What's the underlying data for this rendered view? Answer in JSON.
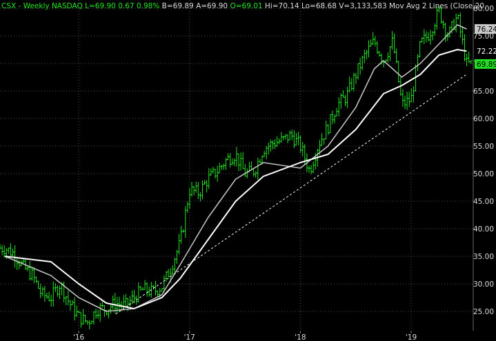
{
  "header": {
    "symbol": "CSX",
    "period": "Weekly",
    "exchange": "NASDAQ",
    "last": "L=69.90",
    "change": "0.67",
    "change_pct": "0.98%",
    "bid": "B=69.89",
    "ask": "A=69.90",
    "open": "O=69.01",
    "high": "Hi=70.14",
    "low": "Lo=68.68",
    "volume": "V=3,133,583",
    "study": "Mov Avg 2 Lines (Close,20,",
    "colors": {
      "accent_green": "#22e622",
      "text": "#dcdcdc"
    }
  },
  "price_tags": [
    {
      "label": "76.24",
      "value": 76.24,
      "bg": "#c8c8c8",
      "fg": "#000000"
    },
    {
      "label": "72.22",
      "value": 72.22,
      "bg": "#000000",
      "fg": "#ffffff"
    },
    {
      "label": "69.89",
      "value": 69.89,
      "bg": "#22dd22",
      "fg": "#000000"
    }
  ],
  "chart_data": {
    "type": "line",
    "title": "",
    "xlabel": "",
    "ylabel": "",
    "ylim": [
      21.5,
      81.5
    ],
    "y_ticks": [
      "25.00",
      "30.00",
      "35.00",
      "40.00",
      "45.00",
      "50.00",
      "55.00",
      "60.00",
      "65.00",
      "70.00",
      "75.00",
      "80.00"
    ],
    "x_ticks": [
      "'16",
      "'17",
      "'18",
      "'19"
    ],
    "grid": true,
    "colors": {
      "bars": "#22e622",
      "ma20": "#c0c0c0",
      "ma40": "#ffffff",
      "trendline": "#ffffff",
      "grid": "#505050",
      "background": "#000000"
    },
    "series": [
      {
        "name": "CSX",
        "type": "ohlc-bars",
        "x": [
          "2015-05",
          "2015-06",
          "2015-07",
          "2015-08",
          "2015-09",
          "2015-10",
          "2015-11",
          "2015-12",
          "2016-01",
          "2016-02",
          "2016-03",
          "2016-04",
          "2016-05",
          "2016-06",
          "2016-07",
          "2016-08",
          "2016-09",
          "2016-10",
          "2016-11",
          "2016-12",
          "2017-01",
          "2017-02",
          "2017-03",
          "2017-04",
          "2017-05",
          "2017-06",
          "2017-07",
          "2017-08",
          "2017-09",
          "2017-10",
          "2017-11",
          "2017-12",
          "2018-01",
          "2018-02",
          "2018-03",
          "2018-04",
          "2018-05",
          "2018-06",
          "2018-07",
          "2018-08",
          "2018-09",
          "2018-10",
          "2018-11",
          "2018-12",
          "2019-01",
          "2019-02",
          "2019-03",
          "2019-04",
          "2019-05",
          "2019-06",
          "2019-07"
        ],
        "values": [
          36.5,
          35.5,
          33.0,
          31.5,
          28.0,
          27.5,
          30.0,
          26.5,
          24.0,
          23.0,
          25.5,
          25.5,
          26.5,
          26.0,
          27.5,
          29.0,
          28.5,
          29.5,
          33.0,
          37.5,
          47.0,
          46.5,
          49.0,
          50.5,
          52.5,
          53.5,
          50.0,
          50.5,
          54.5,
          55.5,
          56.0,
          57.0,
          55.0,
          50.5,
          55.5,
          58.5,
          62.5,
          64.0,
          68.0,
          71.5,
          74.0,
          70.5,
          74.0,
          62.5,
          63.5,
          73.5,
          75.5,
          79.5,
          75.0,
          78.5,
          69.9
        ]
      },
      {
        "name": "",
        "type": "moving-average",
        "x": [
          "2015-05",
          "2015-10",
          "2016-01",
          "2016-04",
          "2016-07",
          "2016-10",
          "2016-12",
          "2017-03",
          "2017-06",
          "2017-09",
          "2018-01",
          "2018-04",
          "2018-07",
          "2018-09",
          "2018-10",
          "2018-12",
          "2019-02",
          "2019-04",
          "2019-06",
          "2019-07"
        ],
        "values": [
          35.0,
          31.5,
          27.5,
          25.0,
          25.5,
          28.0,
          33.5,
          42.0,
          49.0,
          52.0,
          51.0,
          55.0,
          62.0,
          69.0,
          70.5,
          67.5,
          70.0,
          73.5,
          77.0,
          76.24
        ]
      },
      {
        "name": "",
        "type": "moving-average",
        "x": [
          "2015-05",
          "2015-10",
          "2016-01",
          "2016-04",
          "2016-07",
          "2016-10",
          "2016-12",
          "2017-03",
          "2017-06",
          "2017-09",
          "2018-01",
          "2018-04",
          "2018-07",
          "2018-10",
          "2018-12",
          "2019-02",
          "2019-04",
          "2019-06",
          "2019-07"
        ],
        "values": [
          35.0,
          34.0,
          30.0,
          26.5,
          25.5,
          27.5,
          31.0,
          38.0,
          45.0,
          49.5,
          52.0,
          53.5,
          58.0,
          64.5,
          66.0,
          68.0,
          71.5,
          72.5,
          72.22
        ]
      },
      {
        "name": "",
        "type": "trendline",
        "x": [
          "2016-05",
          "2019-07"
        ],
        "values": [
          24.5,
          68.0
        ]
      }
    ]
  }
}
